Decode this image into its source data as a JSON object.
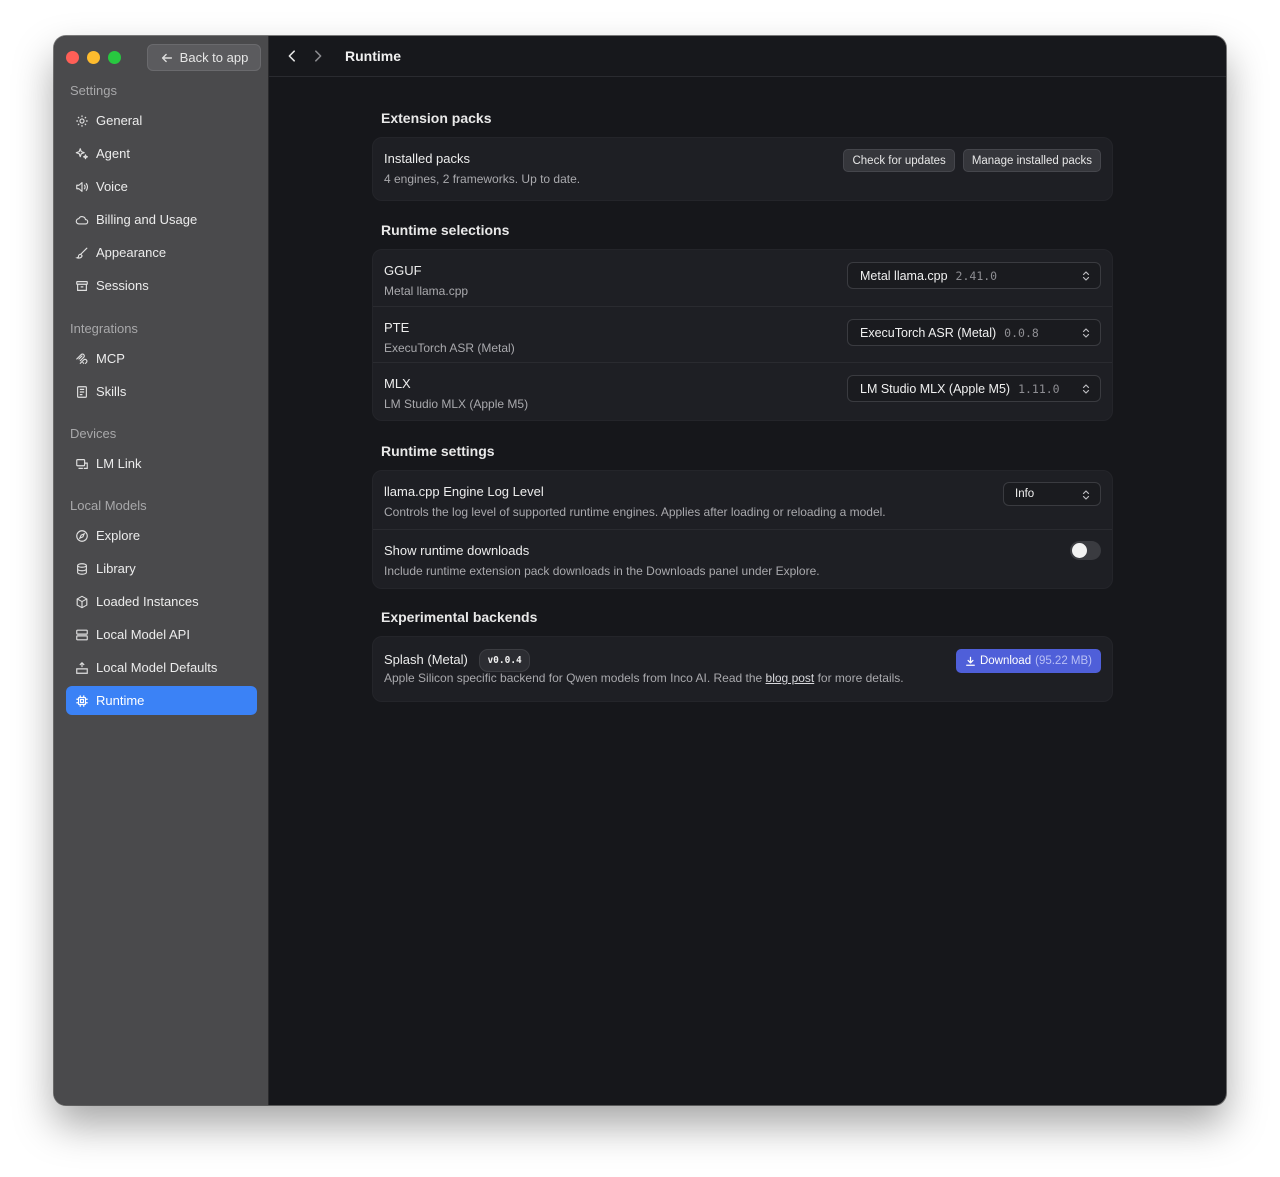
{
  "sidebar": {
    "back_label": "Back to app",
    "settings": {
      "heading": "Settings",
      "items": [
        {
          "label": "General",
          "icon": "gear-icon"
        },
        {
          "label": "Agent",
          "icon": "sparkle-icon"
        },
        {
          "label": "Voice",
          "icon": "speaker-icon"
        },
        {
          "label": "Billing and Usage",
          "icon": "cloud-icon"
        },
        {
          "label": "Appearance",
          "icon": "brush-icon"
        },
        {
          "label": "Sessions",
          "icon": "archive-icon"
        }
      ]
    },
    "integrations": {
      "heading": "Integrations",
      "items": [
        {
          "label": "MCP",
          "icon": "mcp-icon"
        },
        {
          "label": "Skills",
          "icon": "skills-icon"
        }
      ]
    },
    "devices": {
      "heading": "Devices",
      "items": [
        {
          "label": "LM Link",
          "icon": "link-icon"
        }
      ]
    },
    "local_models": {
      "heading": "Local Models",
      "items": [
        {
          "label": "Explore",
          "icon": "compass-icon"
        },
        {
          "label": "Library",
          "icon": "database-icon"
        },
        {
          "label": "Loaded Instances",
          "icon": "cube-icon"
        },
        {
          "label": "Local Model API",
          "icon": "server-icon"
        },
        {
          "label": "Local Model Defaults",
          "icon": "defaults-icon"
        },
        {
          "label": "Runtime",
          "icon": "chip-icon",
          "active": true
        }
      ]
    }
  },
  "topbar": {
    "title": "Runtime"
  },
  "extension_packs": {
    "title": "Extension packs",
    "installed_title": "Installed packs",
    "installed_sub": "4 engines, 2 frameworks. Up to date.",
    "check_updates": "Check for updates",
    "manage_packs": "Manage installed packs"
  },
  "runtime_selections": {
    "title": "Runtime selections",
    "rows": [
      {
        "name": "GGUF",
        "sub": "Metal llama.cpp",
        "select": "Metal llama.cpp",
        "version": "2.41.0"
      },
      {
        "name": "PTE",
        "sub": "ExecuTorch ASR (Metal)",
        "select": "ExecuTorch ASR (Metal)",
        "version": "0.0.8"
      },
      {
        "name": "MLX",
        "sub": "LM Studio MLX (Apple M5)",
        "select": "LM Studio MLX (Apple M5)",
        "version": "1.11.0"
      }
    ]
  },
  "runtime_settings": {
    "title": "Runtime settings",
    "log_level_title": "llama.cpp Engine Log Level",
    "log_level_sub": "Controls the log level of supported runtime engines. Applies after loading or reloading a model.",
    "log_level_value": "Info",
    "downloads_title": "Show runtime downloads",
    "downloads_sub": "Include runtime extension pack downloads in the Downloads panel under Explore.",
    "downloads_enabled": false
  },
  "experimental": {
    "title": "Experimental backends",
    "name": "Splash (Metal)",
    "version": "v0.0.4",
    "sub_before": "Apple Silicon specific backend for Qwen models from Inco AI. Read the",
    "link": "blog post",
    "sub_after": "for more details.",
    "download_label": "Download",
    "download_size": "(95.22 MB)"
  },
  "colors": {
    "accent": "#3b82f6",
    "download": "#4f5fd9"
  }
}
